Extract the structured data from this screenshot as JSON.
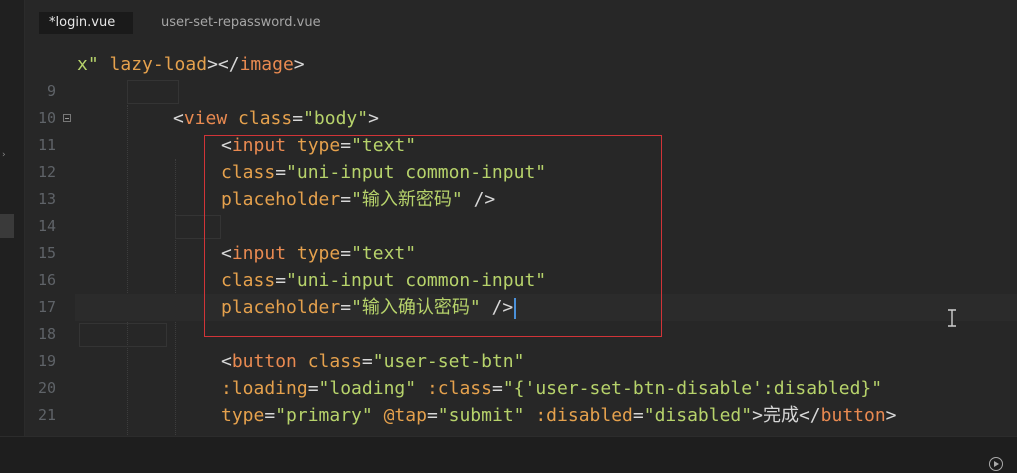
{
  "tabs": [
    {
      "label": "*login.vue",
      "active": true
    },
    {
      "label": "user-set-repassword.vue",
      "active": false
    }
  ],
  "lines": [
    {
      "num": "",
      "segments": [
        {
          "t": "x\"",
          "c": "str"
        },
        {
          "t": " ",
          "c": "plain"
        },
        {
          "t": "lazy-load",
          "c": "attr"
        },
        {
          "t": "></",
          "c": "tag-punc"
        },
        {
          "t": "image",
          "c": "tag-name"
        },
        {
          "t": ">",
          "c": "tag-punc"
        }
      ]
    },
    {
      "num": "9",
      "segments": []
    },
    {
      "num": "10",
      "segments": [
        {
          "t": "<",
          "c": "tag-punc"
        },
        {
          "t": "view",
          "c": "tag-name"
        },
        {
          "t": " ",
          "c": "plain"
        },
        {
          "t": "class",
          "c": "attr"
        },
        {
          "t": "=",
          "c": "plain"
        },
        {
          "t": "\"body\"",
          "c": "str"
        },
        {
          "t": ">",
          "c": "tag-punc"
        }
      ]
    },
    {
      "num": "11",
      "segments": [
        {
          "t": "<",
          "c": "tag-punc"
        },
        {
          "t": "input",
          "c": "tag-name"
        },
        {
          "t": " ",
          "c": "plain"
        },
        {
          "t": "type",
          "c": "attr"
        },
        {
          "t": "=",
          "c": "plain"
        },
        {
          "t": "\"text\"",
          "c": "str"
        }
      ]
    },
    {
      "num": "12",
      "segments": [
        {
          "t": "class",
          "c": "attr"
        },
        {
          "t": "=",
          "c": "plain"
        },
        {
          "t": "\"uni-input common-input\"",
          "c": "str"
        }
      ]
    },
    {
      "num": "13",
      "segments": [
        {
          "t": "placeholder",
          "c": "attr"
        },
        {
          "t": "=",
          "c": "plain"
        },
        {
          "t": "\"输入新密码\"",
          "c": "str"
        },
        {
          "t": " />",
          "c": "tag-punc"
        }
      ]
    },
    {
      "num": "14",
      "segments": []
    },
    {
      "num": "15",
      "segments": [
        {
          "t": "<",
          "c": "tag-punc"
        },
        {
          "t": "input",
          "c": "tag-name"
        },
        {
          "t": " ",
          "c": "plain"
        },
        {
          "t": "type",
          "c": "attr"
        },
        {
          "t": "=",
          "c": "plain"
        },
        {
          "t": "\"text\"",
          "c": "str"
        }
      ]
    },
    {
      "num": "16",
      "segments": [
        {
          "t": "class",
          "c": "attr"
        },
        {
          "t": "=",
          "c": "plain"
        },
        {
          "t": "\"uni-input common-input\"",
          "c": "str"
        }
      ]
    },
    {
      "num": "17",
      "segments": [
        {
          "t": "placeholder",
          "c": "attr"
        },
        {
          "t": "=",
          "c": "plain"
        },
        {
          "t": "\"输入确认密码\"",
          "c": "str"
        },
        {
          "t": " />",
          "c": "tag-punc"
        }
      ]
    },
    {
      "num": "18",
      "segments": []
    },
    {
      "num": "19",
      "segments": [
        {
          "t": "<",
          "c": "tag-punc"
        },
        {
          "t": "button",
          "c": "tag-name"
        },
        {
          "t": " ",
          "c": "plain"
        },
        {
          "t": "class",
          "c": "attr"
        },
        {
          "t": "=",
          "c": "plain"
        },
        {
          "t": "\"user-set-btn\"",
          "c": "str"
        }
      ]
    },
    {
      "num": "20",
      "segments": [
        {
          "t": ":loading",
          "c": "attr"
        },
        {
          "t": "=",
          "c": "plain"
        },
        {
          "t": "\"loading\"",
          "c": "str"
        },
        {
          "t": " ",
          "c": "plain"
        },
        {
          "t": ":class",
          "c": "attr"
        },
        {
          "t": "=",
          "c": "plain"
        },
        {
          "t": "\"{'user-set-btn-disable':disabled}\"",
          "c": "str"
        }
      ]
    },
    {
      "num": "21",
      "segments": [
        {
          "t": "type",
          "c": "attr"
        },
        {
          "t": "=",
          "c": "plain"
        },
        {
          "t": "\"primary\"",
          "c": "str"
        },
        {
          "t": " ",
          "c": "plain"
        },
        {
          "t": "@tap",
          "c": "attr"
        },
        {
          "t": "=",
          "c": "plain"
        },
        {
          "t": "\"submit\"",
          "c": "str"
        },
        {
          "t": " ",
          "c": "plain"
        },
        {
          "t": ":disabled",
          "c": "attr"
        },
        {
          "t": "=",
          "c": "plain"
        },
        {
          "t": "\"disabled\"",
          "c": "str"
        },
        {
          "t": ">",
          "c": "tag-punc"
        },
        {
          "t": "完成",
          "c": "plain"
        },
        {
          "t": "</",
          "c": "tag-punc"
        },
        {
          "t": "button",
          "c": "tag-name"
        },
        {
          "t": ">",
          "c": "tag-punc"
        }
      ]
    }
  ],
  "colors": {
    "tag_name": "#e98a51",
    "attribute": "#e5a14d",
    "string": "#b7d36b",
    "highlight_box": "#d13438",
    "cursor": "#4a90d9"
  }
}
